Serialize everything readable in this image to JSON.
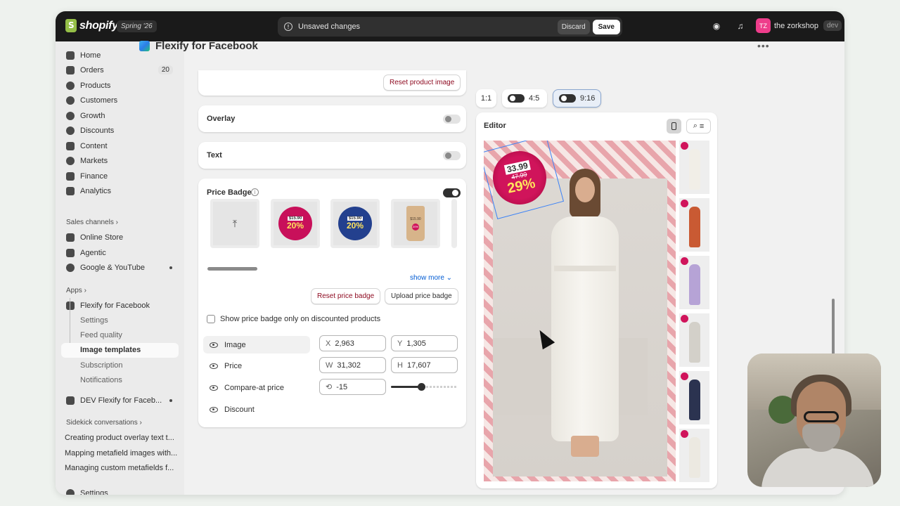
{
  "topbar": {
    "brand": "shopify",
    "season": "Spring '26",
    "unsaved_message": "Unsaved changes",
    "discard_label": "Discard",
    "save_label": "Save",
    "store_initials": "TZ",
    "store_name": "the zorkshop",
    "store_env": "dev"
  },
  "sidebar": {
    "items": [
      {
        "label": "Home",
        "icon": "home-icon"
      },
      {
        "label": "Orders",
        "icon": "orders-icon",
        "count": "20"
      },
      {
        "label": "Products",
        "icon": "tag-icon"
      },
      {
        "label": "Customers",
        "icon": "person-icon"
      },
      {
        "label": "Growth",
        "icon": "growth-icon"
      },
      {
        "label": "Discounts",
        "icon": "discount-icon"
      },
      {
        "label": "Content",
        "icon": "content-icon"
      },
      {
        "label": "Markets",
        "icon": "globe-icon"
      },
      {
        "label": "Finance",
        "icon": "bank-icon"
      },
      {
        "label": "Analytics",
        "icon": "chart-icon"
      }
    ],
    "sales_channels_label": "Sales channels",
    "channels": [
      {
        "label": "Online Store",
        "icon": "store-icon"
      },
      {
        "label": "Agentic",
        "icon": "agentic-icon"
      },
      {
        "label": "Google & YouTube",
        "icon": "google-icon"
      }
    ],
    "apps_label": "Apps",
    "app_name": "Flexify for Facebook",
    "app_subitems": [
      "Settings",
      "Feed quality",
      "Image templates",
      "Subscription",
      "Notifications"
    ],
    "dev_app": "DEV Flexify for Faceb...",
    "sidekick_label": "Sidekick conversations",
    "conversations": [
      "Creating product overlay text t...",
      "Mapping metafield images with...",
      "Managing custom metafields f..."
    ],
    "settings_label": "Settings"
  },
  "page": {
    "title": "Flexify for Facebook"
  },
  "panel": {
    "reset_product_image": "Reset product image",
    "overlay_label": "Overlay",
    "text_label": "Text",
    "price_badge_label": "Price Badge",
    "badges": [
      {
        "old": "$15.90",
        "pct": "20%",
        "color": "#c8105a",
        "pct_color": "#ffe45c"
      },
      {
        "old": "$15.90",
        "pct": "20%",
        "color": "#23408e",
        "pct_color": "#ffe45c"
      }
    ],
    "tag_price": "$15.90",
    "tag_pct": "20%",
    "show_more": "show more",
    "reset_price_badge": "Reset price badge",
    "upload_price_badge": "Upload price badge",
    "discount_only_label": "Show price badge only on discounted products",
    "layers": [
      "Image",
      "Price",
      "Compare-at price",
      "Discount"
    ],
    "fields": {
      "x_label": "X",
      "x_value": "2,963",
      "y_label": "Y",
      "y_value": "1,305",
      "w_label": "W",
      "w_value": "31,302",
      "h_label": "H",
      "h_value": "17,607",
      "rotation_value": "-15"
    }
  },
  "ratios": [
    "1:1",
    "4:5",
    "9:16"
  ],
  "editor": {
    "title": "Editor",
    "badge_price": "33.99",
    "badge_old": "47.99",
    "badge_pct": "29%",
    "dress_colors": [
      "#f1eee7",
      "#c95a33",
      "#b6a3d6",
      "#d3d0c9",
      "#2b3350",
      "#ece9e1"
    ]
  }
}
